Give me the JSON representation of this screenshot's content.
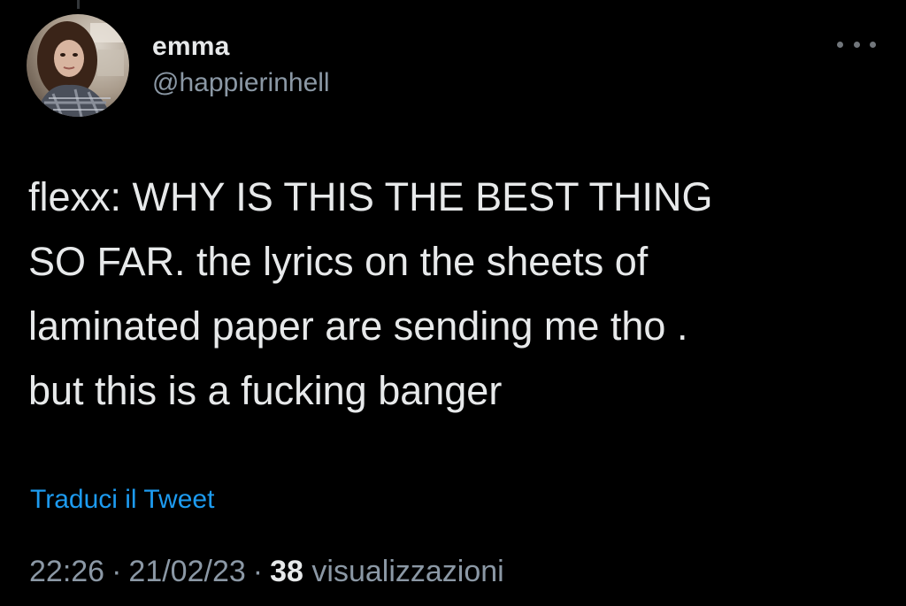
{
  "tweet": {
    "author": {
      "display_name": "emma",
      "handle": "@happierinhell",
      "avatar_icon": "profile-photo"
    },
    "more_icon": "ellipsis-horizontal-icon",
    "text_lines": [
      "flexx: WHY IS THIS THE BEST THING",
      "SO FAR. the lyrics on the sheets of",
      "laminated paper are sending me tho .",
      "but this is a fucking banger"
    ],
    "translate_label": "Traduci il Tweet",
    "time": "22:26",
    "date": "21/02/23",
    "separator": "·",
    "views_count": "38",
    "views_label": "visualizzazioni"
  },
  "colors": {
    "background": "#000000",
    "text_primary": "#e7e9ea",
    "text_secondary": "#8b98a5",
    "link": "#1d9bf0"
  }
}
